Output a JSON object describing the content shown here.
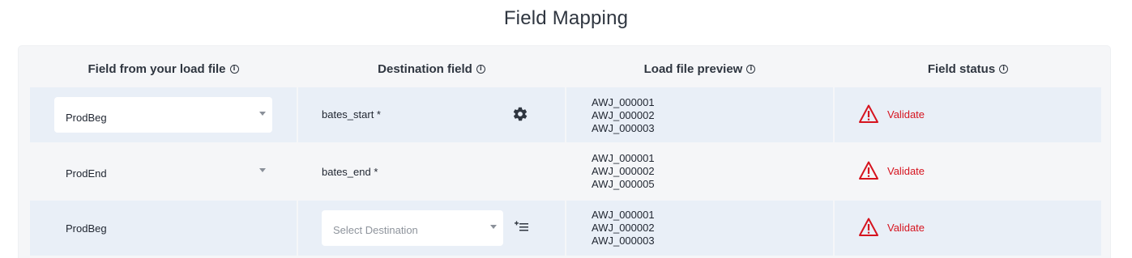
{
  "page": {
    "title": "Field Mapping"
  },
  "columns": [
    {
      "label": "Field from your load file"
    },
    {
      "label": "Destination field"
    },
    {
      "label": "Load file preview"
    },
    {
      "label": "Field status"
    }
  ],
  "rows": [
    {
      "source_field": "ProdBeg",
      "destination": "bates_start *",
      "preview": [
        "AWJ_000001",
        "AWJ_000002",
        "AWJ_000003"
      ],
      "status": "Validate"
    },
    {
      "source_field": "ProdEnd",
      "destination": "bates_end *",
      "preview": [
        "AWJ_000001",
        "AWJ_000002",
        "AWJ_000005"
      ],
      "status": "Validate"
    },
    {
      "source_field": "ProdBeg",
      "destination_placeholder": "Select Destination",
      "preview": [
        "AWJ_000001",
        "AWJ_000002",
        "AWJ_000003"
      ],
      "status": "Validate"
    }
  ],
  "icons": {
    "info": "info-circle-icon",
    "settings": "gear-icon",
    "add_field": "add-list-icon",
    "warning": "warning-triangle-icon",
    "dropdown": "caret-down-icon"
  },
  "colors": {
    "warning_red": "#d6141f",
    "row_shaded": "#e9eff7",
    "panel_bg": "#f5f6f8"
  }
}
